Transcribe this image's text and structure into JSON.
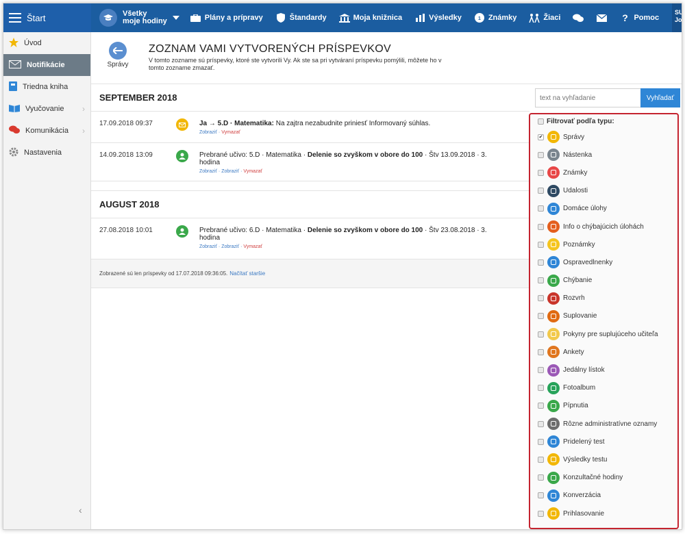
{
  "topbar": {
    "start": "Štart",
    "hours": {
      "line1": "Všetky",
      "line2": "moje hodiny"
    },
    "nav": [
      {
        "label": "Plány a prípravy",
        "icon": "briefcase-icon"
      },
      {
        "label": "Štandardy",
        "icon": "shield-icon"
      },
      {
        "label": "Moja knižnica",
        "icon": "library-icon"
      },
      {
        "label": "Výsledky",
        "icon": "bar-chart-icon"
      },
      {
        "label": "Známky",
        "icon": "grade-icon"
      },
      {
        "label": "Žiaci",
        "icon": "students-icon"
      },
      {
        "label": "",
        "icon": "chat-icon"
      },
      {
        "label": "",
        "icon": "mail-icon"
      },
      {
        "label": "Pomoc",
        "icon": "help-icon"
      }
    ],
    "user": {
      "line1": "SU",
      "line2": "Jo"
    }
  },
  "sidebar": {
    "items": [
      {
        "label": "Úvod",
        "icon": "star-icon",
        "color": "#f2b705"
      },
      {
        "label": "Notifikácie",
        "icon": "envelope-icon",
        "color": "#ffffff"
      },
      {
        "label": "Triedna kniha",
        "icon": "book-icon",
        "color": "#2f86d6"
      },
      {
        "label": "Vyučovanie",
        "icon": "open-book-icon",
        "color": "#2f86d6"
      },
      {
        "label": "Komunikácia",
        "icon": "chat-icon",
        "color": "#d93a2f"
      },
      {
        "label": "Nastavenia",
        "icon": "gear-icon",
        "color": "#888888"
      }
    ],
    "collapse": "‹"
  },
  "header": {
    "back_label": "Správy",
    "title": "ZOZNAM VAMI VYTVORENÝCH PRÍSPEVKOV",
    "desc": "V tomto zozname sú príspevky, ktoré ste vytvorili Vy. Ak ste sa pri vytváraní príspevku pomýlili, môžete ho v tomto zozname zmazať."
  },
  "search": {
    "placeholder": "text na vyhľadanie",
    "button": "Vyhľadať"
  },
  "months": [
    {
      "title": "SEPTEMBER 2018",
      "rows": [
        {
          "date": "17.09.2018 09:37",
          "icon_color": "#f2b705",
          "bold": "Ja → 5.D · Matematika:",
          "text": " Na zajtra nezabudnite priniesť Informovaný súhlas.",
          "links": [
            "Zobraziť"
          ],
          "delete": "Vymazať"
        },
        {
          "date": "14.09.2018 13:09",
          "icon_color": "#3aa84a",
          "pre": "Prebrané učivo: 5.D · Matematika · ",
          "bold": "Delenie so zvyškom v obore do 100",
          "post": " · Štv 13.09.2018 · 3. hodina",
          "links": [
            "Zobraziť",
            "Zobraziť"
          ],
          "delete": "Vymazať"
        }
      ]
    },
    {
      "title": "AUGUST 2018",
      "rows": [
        {
          "date": "27.08.2018 10:01",
          "icon_color": "#3aa84a",
          "pre": "Prebrané učivo: 6.D · Matematika · ",
          "bold": "Delenie so zvyškom v obore do 100",
          "post": " · Štv 23.08.2018 · 3. hodina",
          "links": [
            "Zobraziť",
            "Zobraziť"
          ],
          "delete": "Vymazať"
        }
      ]
    }
  ],
  "footer": {
    "text": "Zobrazené sú len príspevky od 17.07.2018 09:36:05.",
    "link": "Načítať staršie"
  },
  "filter": {
    "title": "Filtrovať podľa typu:",
    "items": [
      {
        "label": "Správy",
        "color": "#f2b705",
        "checked": true
      },
      {
        "label": "Nástenka",
        "color": "#7a858e",
        "checked": false
      },
      {
        "label": "Známky",
        "color": "#e84747",
        "checked": false
      },
      {
        "label": "Udalosti",
        "color": "#2f4a63",
        "checked": false
      },
      {
        "label": "Domáce úlohy",
        "color": "#2f86d6",
        "checked": false
      },
      {
        "label": "Info o chýbajúcich úlohách",
        "color": "#e45f1e",
        "checked": false
      },
      {
        "label": "Poznámky",
        "color": "#f5c520",
        "checked": false
      },
      {
        "label": "Ospravedlnenky",
        "color": "#2f86d6",
        "checked": false
      },
      {
        "label": "Chýbanie",
        "color": "#3aa84a",
        "checked": false
      },
      {
        "label": "Rozvrh",
        "color": "#c9352b",
        "checked": false
      },
      {
        "label": "Suplovanie",
        "color": "#e06a12",
        "checked": false
      },
      {
        "label": "Pokyny pre suplujúceho učiteľa",
        "color": "#f2c94c",
        "checked": false
      },
      {
        "label": "Ankety",
        "color": "#e0761f",
        "checked": false
      },
      {
        "label": "Jedálny lístok",
        "color": "#9b59b6",
        "checked": false
      },
      {
        "label": "Fotoalbum",
        "color": "#27a35a",
        "checked": false
      },
      {
        "label": "Pípnutia",
        "color": "#3aa84a",
        "checked": false
      },
      {
        "label": "Rôzne administratívne oznamy",
        "color": "#6d6d6d",
        "checked": false
      },
      {
        "label": "Pridelený test",
        "color": "#2f86d6",
        "checked": false
      },
      {
        "label": "Výsledky testu",
        "color": "#f2b705",
        "checked": false
      },
      {
        "label": "Konzultačné hodiny",
        "color": "#3aa84a",
        "checked": false
      },
      {
        "label": "Konverzácia",
        "color": "#2f86d6",
        "checked": false
      },
      {
        "label": "Prihlasovanie",
        "color": "#f2b705",
        "checked": false
      }
    ]
  }
}
